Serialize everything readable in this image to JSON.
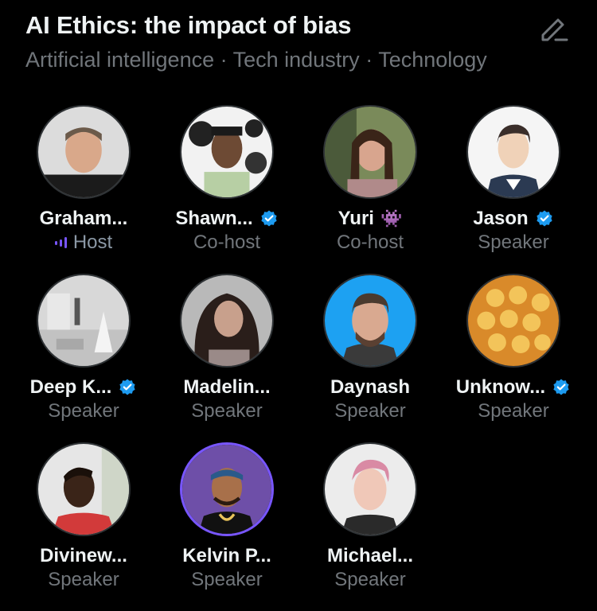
{
  "space": {
    "title": "AI Ethics: the impact of bias",
    "topics": "Artificial intelligence · Tech industry · Technology"
  },
  "icons": {
    "edit": "pencil-edit-icon",
    "verified": "verified-badge-icon",
    "speaking": "audio-bars-icon",
    "alien": "alien-monster-emoji"
  },
  "colors": {
    "background": "#000000",
    "verified": "#1d9bf0",
    "speaking": "#7856ff",
    "secondary_text": "#71767b"
  },
  "participants": [
    {
      "name": "Graham...",
      "role": "Host",
      "verified": false,
      "speaking": true
    },
    {
      "name": "Shawn...",
      "role": "Co-host",
      "verified": true,
      "speaking": false
    },
    {
      "name": "Yuri",
      "name_emoji": "👾",
      "role": "Co-host",
      "verified": false,
      "speaking": false
    },
    {
      "name": "Jason",
      "role": "Speaker",
      "verified": true,
      "speaking": false
    },
    {
      "name": "Deep K...",
      "role": "Speaker",
      "verified": true,
      "speaking": false
    },
    {
      "name": "Madelin...",
      "role": "Speaker",
      "verified": false,
      "speaking": false
    },
    {
      "name": "Daynash",
      "role": "Speaker",
      "verified": false,
      "speaking": false
    },
    {
      "name": "Unknow...",
      "role": "Speaker",
      "verified": true,
      "speaking": false
    },
    {
      "name": "Divinew...",
      "role": "Speaker",
      "verified": false,
      "speaking": false
    },
    {
      "name": "Kelvin P...",
      "role": "Speaker",
      "verified": false,
      "speaking": false,
      "avatar_ring": true
    },
    {
      "name": "Michael...",
      "role": "Speaker",
      "verified": false,
      "speaking": false
    }
  ]
}
